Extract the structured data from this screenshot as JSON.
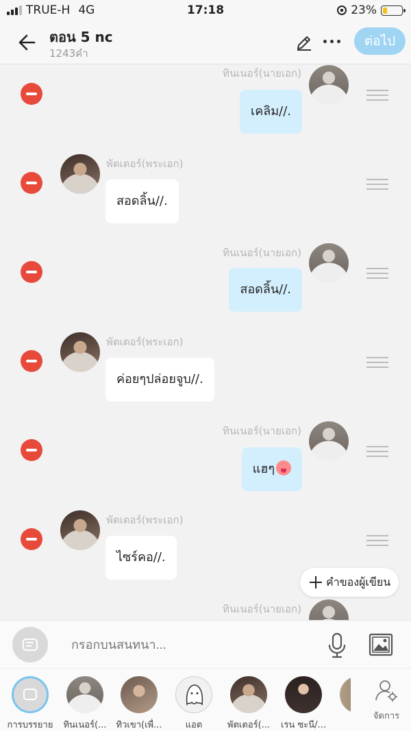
{
  "status": {
    "carrier": "TRUE-H",
    "network": "4G",
    "time": "17:18",
    "battery": "23%"
  },
  "header": {
    "title": "ตอน 5 nc",
    "subtitle": "1243คำ",
    "next_label": "ต่อไป"
  },
  "messages": [
    {
      "side": "right",
      "speaker": "ทินเนอร์(นายเอก)",
      "text": "เคลิม//."
    },
    {
      "side": "left",
      "speaker": "พัตเตอร์(พระเอก)",
      "text": "สอดลิ้น//."
    },
    {
      "side": "right",
      "speaker": "ทินเนอร์(นายเอก)",
      "text": "สอดลิ้น//."
    },
    {
      "side": "left",
      "speaker": "พัตเตอร์(พระเอก)",
      "text": "ค่อยๆปล่อยจูบ//."
    },
    {
      "side": "right",
      "speaker": "ทินเนอร์(นายเอก)",
      "text": "แฮๆ",
      "emoji": "hot-face-emoji"
    },
    {
      "side": "left",
      "speaker": "พัตเตอร์(พระเอก)",
      "text": "ไซร์คอ//."
    },
    {
      "side": "right",
      "speaker": "ทินเนอร์(นายเอก)",
      "text": ""
    }
  ],
  "writer_note_label": "คำของผู้เขียน",
  "composer": {
    "placeholder": "กรอกบนสนทนา..."
  },
  "characters": [
    {
      "label": "การบรรยาย",
      "style": "narr"
    },
    {
      "label": "ทินเนอร์(...",
      "style": "av-narrator"
    },
    {
      "label": "ทิวเขา(เพื่...",
      "style": "av-third"
    },
    {
      "label": "แอต",
      "style": "av-ghost"
    },
    {
      "label": "พัตเตอร์(...",
      "style": "av-main"
    },
    {
      "label": "เรน ซะนี/...",
      "style": "av-girl"
    },
    {
      "label": "",
      "style": "av-partial"
    }
  ],
  "manage_label": "จัดการ",
  "colors": {
    "accent": "#9fd4f3",
    "remove": "#e74a3b",
    "bubble_right": "#d3effd",
    "bubble_left": "#ffffff"
  }
}
